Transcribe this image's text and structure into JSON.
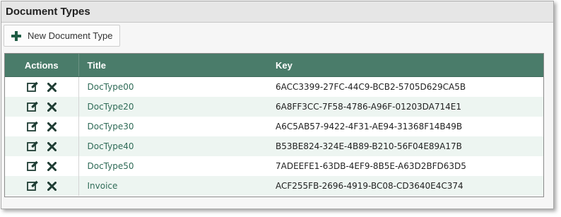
{
  "panel": {
    "title": "Document Types"
  },
  "toolbar": {
    "new_label": "New Document Type"
  },
  "colors": {
    "header_bg": "#4a7c6a",
    "title_link": "#2f6b57",
    "icon_dark": "#1f3d34",
    "alt_row": "#edf5f1"
  },
  "table": {
    "columns": [
      "Actions",
      "Title",
      "Key"
    ],
    "rows": [
      {
        "title": "DocType00",
        "key": "6ACC3399-27FC-44C9-BCB2-5705D629CA5B"
      },
      {
        "title": "DocType20",
        "key": "6A8FF3CC-7F58-4786-A96F-01203DA714E1"
      },
      {
        "title": "DocType30",
        "key": "A6C5AB57-9422-4F31-AE94-31368F14B49B"
      },
      {
        "title": "DocType40",
        "key": "B53BE824-324E-4B89-B210-56F04E89A17B"
      },
      {
        "title": "DocType50",
        "key": "7ADEEFE1-63DB-4EF9-8B5E-A63D2BFD63D5"
      },
      {
        "title": "Invoice",
        "key": "ACF255FB-2696-4919-BC08-CD3640E4C374"
      }
    ]
  },
  "icons": {
    "new": "plus-icon",
    "edit": "edit-icon",
    "delete": "delete-icon"
  }
}
